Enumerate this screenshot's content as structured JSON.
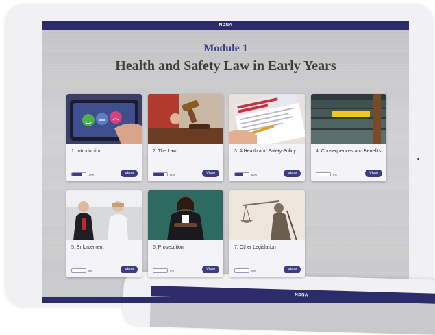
{
  "app": {
    "logo": "NDNA"
  },
  "module": {
    "label": "Module  1",
    "title": "Health and Safety Law in Early Years"
  },
  "cards": [
    {
      "num": "1.",
      "title": "Introduction",
      "progress": 0.75,
      "progress_text": "75%",
      "view": "View",
      "image": "emoji-faces-tablet-icon"
    },
    {
      "num": "2.",
      "title": "The Law",
      "progress": 0.8,
      "progress_text": "80%",
      "view": "View",
      "image": "gavel-icon"
    },
    {
      "num": "3.",
      "title": "A Health and Safety Policy",
      "progress": 0.6,
      "progress_text": "60%",
      "view": "View",
      "image": "policy-document-icon"
    },
    {
      "num": "4.",
      "title": "Consequences and Benefits",
      "progress": 0.0,
      "progress_text": "0%",
      "view": "View",
      "image": "mind-your-step-stairs-icon"
    },
    {
      "num": "5.",
      "title": "Enforcement",
      "progress": 0.0,
      "progress_text": "0%",
      "view": "View",
      "image": "inspectors-icon"
    },
    {
      "num": "6.",
      "title": "Prosecution",
      "progress": 0.0,
      "progress_text": "0%",
      "view": "View",
      "image": "barrister-icon"
    },
    {
      "num": "7.",
      "title": "Other Legislation",
      "progress": 0.0,
      "progress_text": "0%",
      "view": "View",
      "image": "lady-justice-icon"
    }
  ],
  "colors": {
    "brand": "#2c2c6a",
    "accent": "#3b3b86"
  }
}
